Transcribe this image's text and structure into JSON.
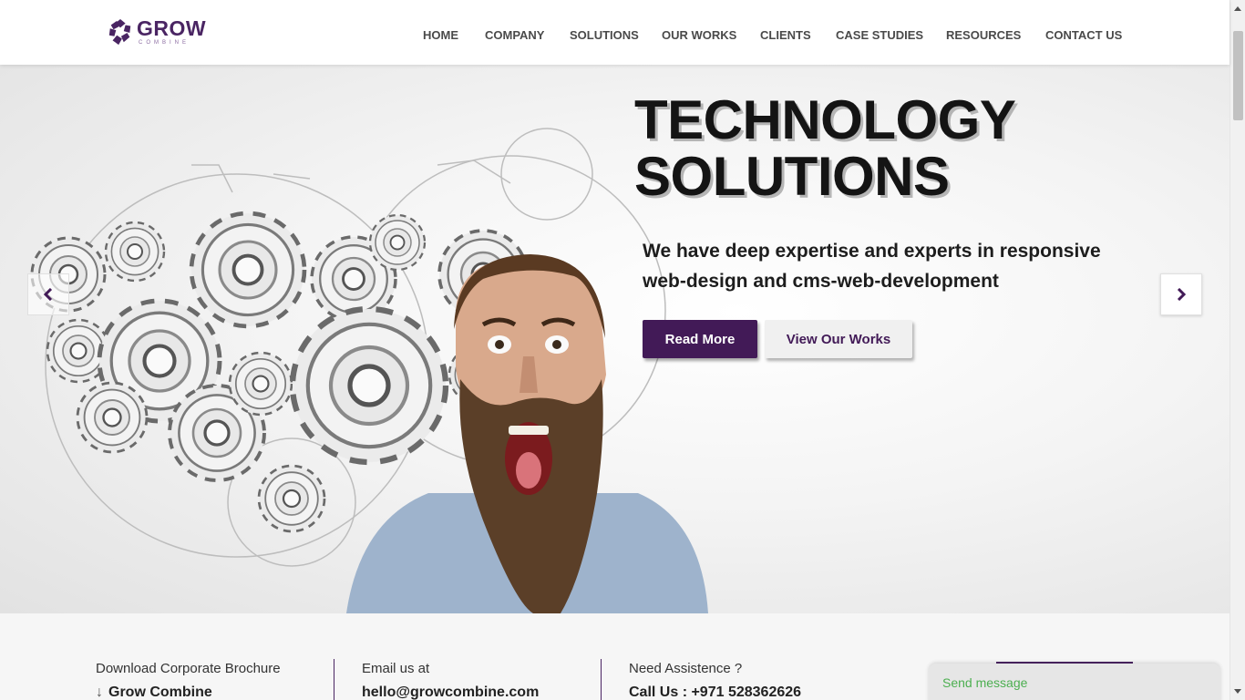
{
  "header": {
    "logo": {
      "word": "GROW",
      "sub": "COMBINE",
      "icon": "grow-combine-logo-icon",
      "color": "#4a2563"
    },
    "nav": [
      {
        "label": "HOME"
      },
      {
        "label": "COMPANY"
      },
      {
        "label": "SOLUTIONS"
      },
      {
        "label": "OUR WORKS"
      },
      {
        "label": "CLIENTS"
      },
      {
        "label": "CASE STUDIES"
      },
      {
        "label": "RESOURCES"
      },
      {
        "label": "CONTACT US"
      }
    ]
  },
  "hero": {
    "title_line1": "TECHNOLOGY",
    "title_line2": "SOLUTIONS",
    "subtitle": "We have deep expertise and experts in responsive web-design and cms-web-development",
    "primary_button": "Read More",
    "secondary_button": "View Our Works",
    "prev_icon": "chevron-left-icon",
    "next_icon": "chevron-right-icon",
    "accent": "#421a57"
  },
  "info": {
    "brochure": {
      "label": "Download Corporate Brochure",
      "value": "Grow Combine",
      "icon": "download-arrow-icon"
    },
    "email": {
      "label": "Email us at",
      "value": "hello@growcombine.com"
    },
    "phone": {
      "label": "Need Assistence ?",
      "value": "Call Us : +971 528362626"
    }
  },
  "chat": {
    "label": "Send message",
    "color": "#4caf50"
  }
}
